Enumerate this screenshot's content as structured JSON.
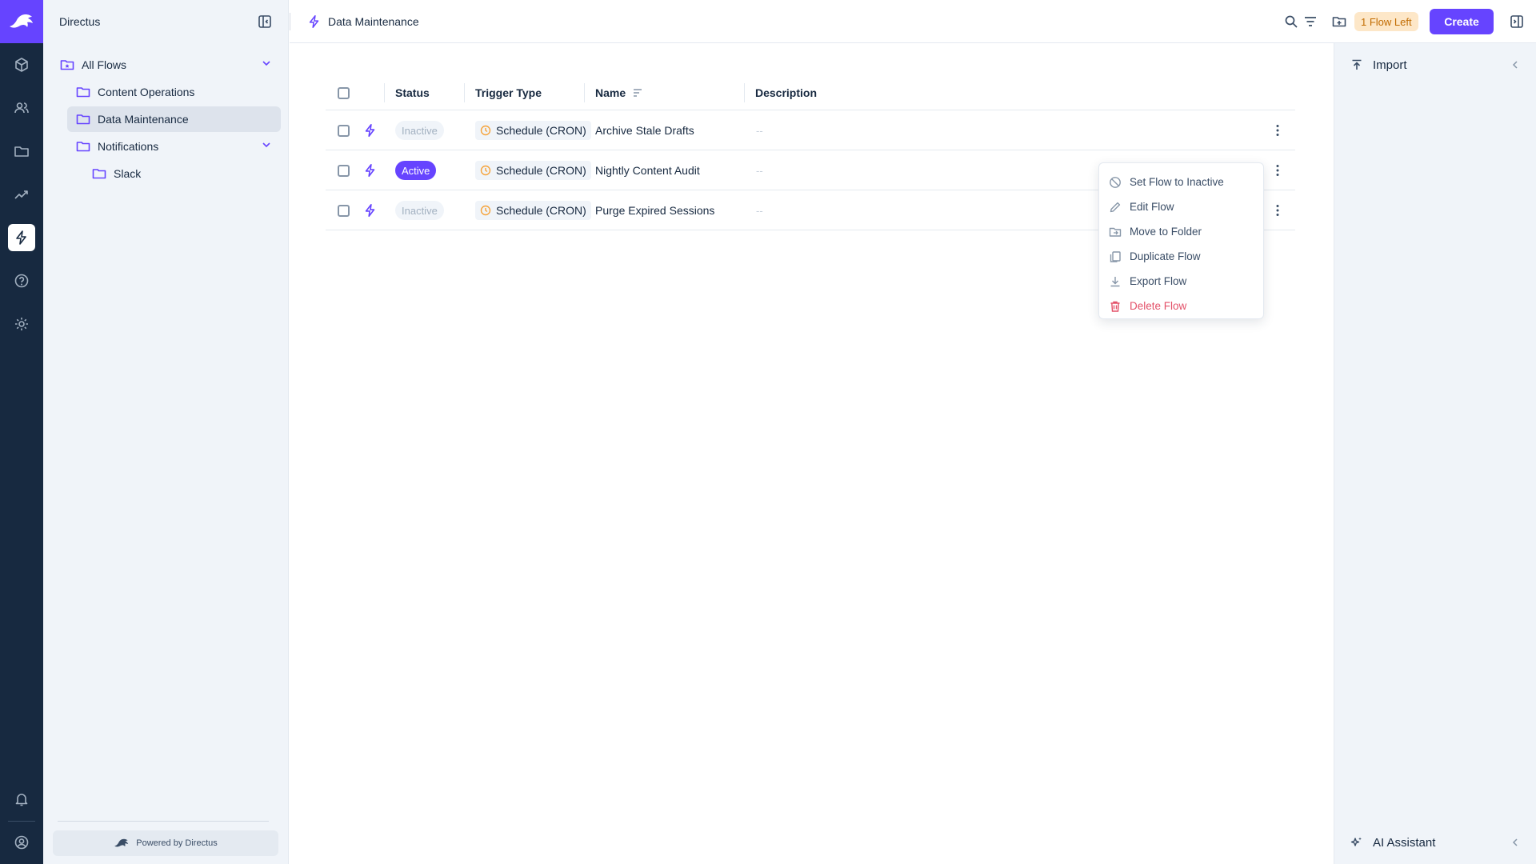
{
  "app": {
    "project_name": "Directus"
  },
  "modules": [
    {
      "name": "content",
      "icon": "cube-icon"
    },
    {
      "name": "users",
      "icon": "users-icon"
    },
    {
      "name": "files",
      "icon": "folder-icon"
    },
    {
      "name": "insights",
      "icon": "insights-icon"
    },
    {
      "name": "flows",
      "icon": "bolt-icon",
      "active": true
    },
    {
      "name": "help",
      "icon": "help-icon"
    },
    {
      "name": "settings",
      "icon": "gear-icon"
    }
  ],
  "sidebar": {
    "tree": [
      {
        "label": "All Flows",
        "expandable": true
      },
      {
        "label": "Content Operations"
      },
      {
        "label": "Data Maintenance",
        "selected": true
      },
      {
        "label": "Notifications",
        "expandable": true
      },
      {
        "label": "Slack"
      }
    ],
    "powered_by": "Powered by Directus"
  },
  "header": {
    "title": "Data Maintenance",
    "flow_left_badge": "1 Flow Left",
    "create_label": "Create"
  },
  "table": {
    "headers": {
      "status": "Status",
      "trigger": "Trigger Type",
      "name": "Name",
      "description": "Description"
    },
    "rows": [
      {
        "status": "Inactive",
        "trigger": "Schedule (CRON)",
        "name": "Archive Stale Drafts",
        "description": "--"
      },
      {
        "status": "Active",
        "trigger": "Schedule (CRON)",
        "name": "Nightly Content Audit",
        "description": "--"
      },
      {
        "status": "Inactive",
        "trigger": "Schedule (CRON)",
        "name": "Purge Expired Sessions",
        "description": "--"
      }
    ]
  },
  "context_menu": {
    "items": [
      {
        "label": "Set Flow to Inactive",
        "icon": "block-icon"
      },
      {
        "label": "Edit Flow",
        "icon": "pencil-icon"
      },
      {
        "label": "Move to Folder",
        "icon": "move-folder-icon"
      },
      {
        "label": "Duplicate Flow",
        "icon": "duplicate-icon"
      },
      {
        "label": "Export Flow",
        "icon": "download-icon"
      },
      {
        "label": "Delete Flow",
        "icon": "trash-icon",
        "danger": true
      }
    ]
  },
  "right_sidebar": {
    "import_label": "Import",
    "ai_label": "AI Assistant"
  },
  "colors": {
    "accent": "#6644ff",
    "module_bar": "#172940",
    "warning_badge_bg": "#fde7c8",
    "warning_badge_text": "#c16b00",
    "danger": "#e35169"
  }
}
